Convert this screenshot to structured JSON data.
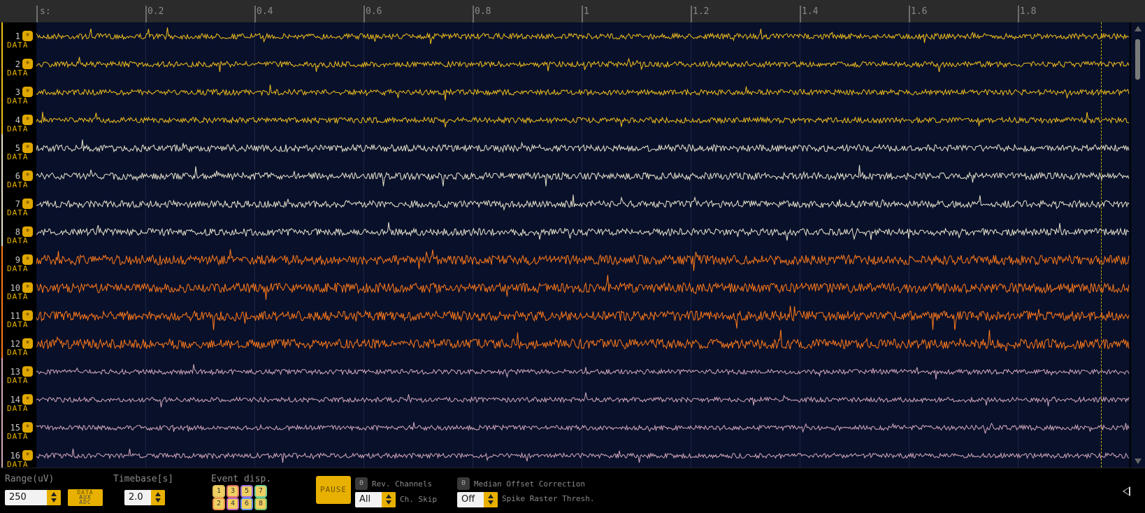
{
  "ruler": {
    "prefix": "s:",
    "ticks": [
      "0.2",
      "0.4",
      "0.6",
      "0.8",
      "1",
      "1.2",
      "1.4",
      "1.6",
      "1.8"
    ]
  },
  "channels": [
    {
      "num": "1",
      "type": "DATA",
      "dot": "*",
      "color": "#f2bf1e"
    },
    {
      "num": "2",
      "type": "DATA",
      "dot": "*",
      "color": "#f2bf1e"
    },
    {
      "num": "3",
      "type": "DATA",
      "dot": "*",
      "color": "#f2bf1e"
    },
    {
      "num": "4",
      "type": "DATA",
      "dot": "*",
      "color": "#f2bf1e"
    },
    {
      "num": "5",
      "type": "DATA",
      "dot": "*",
      "color": "#e9e4cd"
    },
    {
      "num": "6",
      "type": "DATA",
      "dot": "*",
      "color": "#e9e4cd"
    },
    {
      "num": "7",
      "type": "DATA",
      "dot": "*",
      "color": "#e9e4cd"
    },
    {
      "num": "8",
      "type": "DATA",
      "dot": "*",
      "color": "#e9e4cd"
    },
    {
      "num": "9",
      "type": "DATA",
      "dot": "*",
      "color": "#ff7a1a"
    },
    {
      "num": "10",
      "type": "DATA",
      "dot": "*",
      "color": "#ff7a1a"
    },
    {
      "num": "11",
      "type": "DATA",
      "dot": "*",
      "color": "#ff7a1a"
    },
    {
      "num": "12",
      "type": "DATA",
      "dot": "*",
      "color": "#ff7a1a"
    },
    {
      "num": "13",
      "type": "DATA",
      "dot": "*",
      "color": "#d4a9bd"
    },
    {
      "num": "14",
      "type": "DATA",
      "dot": "*",
      "color": "#d4a9bd"
    },
    {
      "num": "15",
      "type": "DATA",
      "dot": "*",
      "color": "#d4a9bd"
    },
    {
      "num": "16",
      "type": "DATA",
      "dot": "*",
      "color": "#d4a9bd"
    }
  ],
  "controls": {
    "range_label": "Range(uV)",
    "range_value": "250",
    "data_stack": [
      "DATA",
      "AUX",
      "ADC"
    ],
    "timebase_label": "Timebase[s]",
    "timebase_value": "2.0",
    "event_label": "Event disp.",
    "events_top": [
      {
        "n": "1",
        "color": "#e0c060"
      },
      {
        "n": "3",
        "color": "#e07070"
      },
      {
        "n": "5",
        "color": "#9f70e0"
      },
      {
        "n": "7",
        "color": "#70d0a0"
      }
    ],
    "events_bottom": [
      {
        "n": "2",
        "color": "#f09050"
      },
      {
        "n": "4",
        "color": "#c060c0"
      },
      {
        "n": "6",
        "color": "#6090f0"
      },
      {
        "n": "8",
        "color": "#70c070"
      }
    ],
    "pause_label": "PAUSE",
    "rev_toggle": "0",
    "rev_label": "Rev. Channels",
    "skip_value": "All",
    "skip_label": "Ch. Skip",
    "median_toggle": "0",
    "median_label": "Median Offset Correction",
    "spike_value": "Off",
    "spike_label": "Spike Raster Thresh."
  },
  "colors": {
    "accent": "#e8b000",
    "background": "#08102a",
    "cursor": "#c7b100"
  }
}
